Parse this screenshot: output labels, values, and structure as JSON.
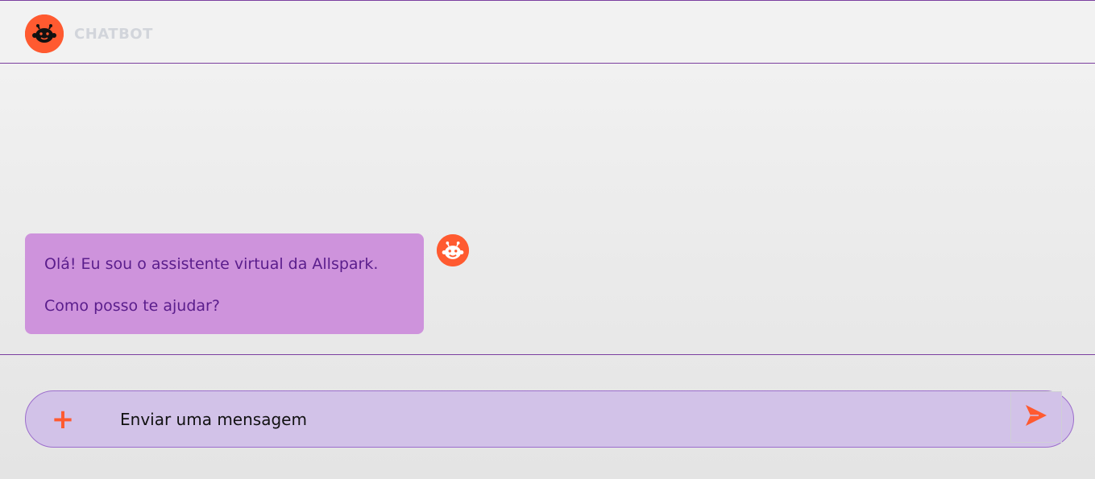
{
  "header": {
    "title": "CHATBOT",
    "logo_icon": "robot-face-icon"
  },
  "chat": {
    "messages": [
      {
        "sender": "bot",
        "lines": [
          "Olá! Eu sou o assistente virtual da Allspark.",
          "Como posso te ajudar?"
        ]
      }
    ]
  },
  "composer": {
    "placeholder": "Enviar uma mensagem",
    "attach_label": "+",
    "send_icon": "send-icon"
  },
  "colors": {
    "accent": "#ff5a30",
    "bubble": "#ce93dc",
    "bubble_text": "#5a1d8c",
    "divider": "#7b3fa0",
    "composer_bg": "#d2c2e8"
  }
}
